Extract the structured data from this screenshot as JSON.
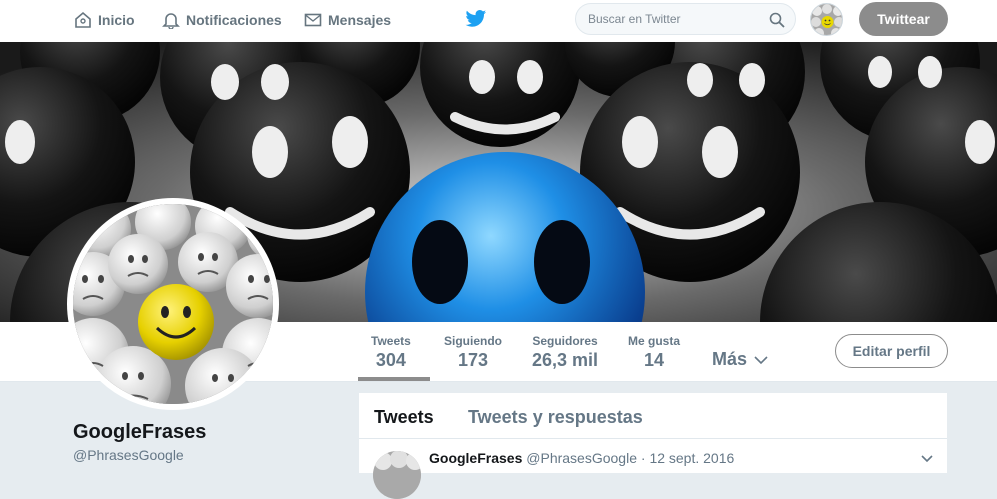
{
  "nav": {
    "home_label": "Inicio",
    "notifications_label": "Notificaciones",
    "messages_label": "Mensajes",
    "search_placeholder": "Buscar en Twitter",
    "tweet_button": "Twittear"
  },
  "stats": [
    {
      "label": "Tweets",
      "value": "304"
    },
    {
      "label": "Siguiendo",
      "value": "173"
    },
    {
      "label": "Seguidores",
      "value": "26,3 mil"
    },
    {
      "label": "Me gusta",
      "value": "14"
    }
  ],
  "more_label": "Más",
  "edit_profile": "Editar perfil",
  "profile": {
    "name": "GoogleFrases",
    "handle": "@PhrasesGoogle"
  },
  "timeline": {
    "tabs": [
      "Tweets",
      "Tweets y respuestas"
    ],
    "tweet": {
      "author": "GoogleFrases",
      "handle": "@PhrasesGoogle",
      "separator": "·",
      "date": "12 sept. 2016"
    }
  },
  "colors": {
    "accent_gray": "#8c8c8c",
    "twitter_blue": "#1da1f2",
    "text_gray": "#657786"
  }
}
